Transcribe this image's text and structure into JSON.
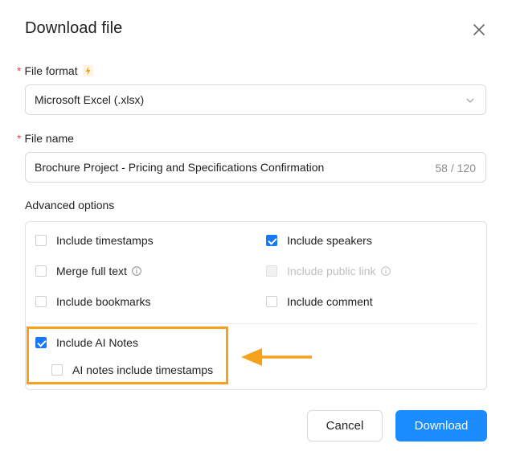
{
  "dialog": {
    "title": "Download file",
    "close_icon": "close-icon"
  },
  "file_format": {
    "required_mark": "*",
    "label": "File format",
    "label_icon": "lightning-icon",
    "value": "Microsoft Excel (.xlsx)",
    "dropdown_icon": "chevron-down-icon"
  },
  "file_name": {
    "required_mark": "*",
    "label": "File name",
    "value": "Brochure Project - Pricing and Specifications Confirmation",
    "counter": "58 / 120"
  },
  "advanced": {
    "label": "Advanced options",
    "options": [
      {
        "label": "Include timestamps",
        "checked": false,
        "disabled": false
      },
      {
        "label": "Include speakers",
        "checked": true,
        "disabled": false
      },
      {
        "label": "Merge full text",
        "checked": false,
        "disabled": false,
        "info": true
      },
      {
        "label": "Include public link",
        "checked": false,
        "disabled": true,
        "info": true
      },
      {
        "label": "Include bookmarks",
        "checked": false,
        "disabled": false
      },
      {
        "label": "Include comment",
        "checked": false,
        "disabled": false
      }
    ],
    "ai_notes": {
      "label": "Include AI Notes",
      "checked": true
    },
    "ai_notes_timestamps": {
      "label": "AI notes include timestamps",
      "checked": false
    }
  },
  "annotation": {
    "highlight_color": "#f5a11c",
    "arrow_icon": "arrow-left-icon"
  },
  "actions": {
    "cancel": "Cancel",
    "download": "Download"
  },
  "colors": {
    "primary": "#1a8cff",
    "required": "#e8483f"
  }
}
